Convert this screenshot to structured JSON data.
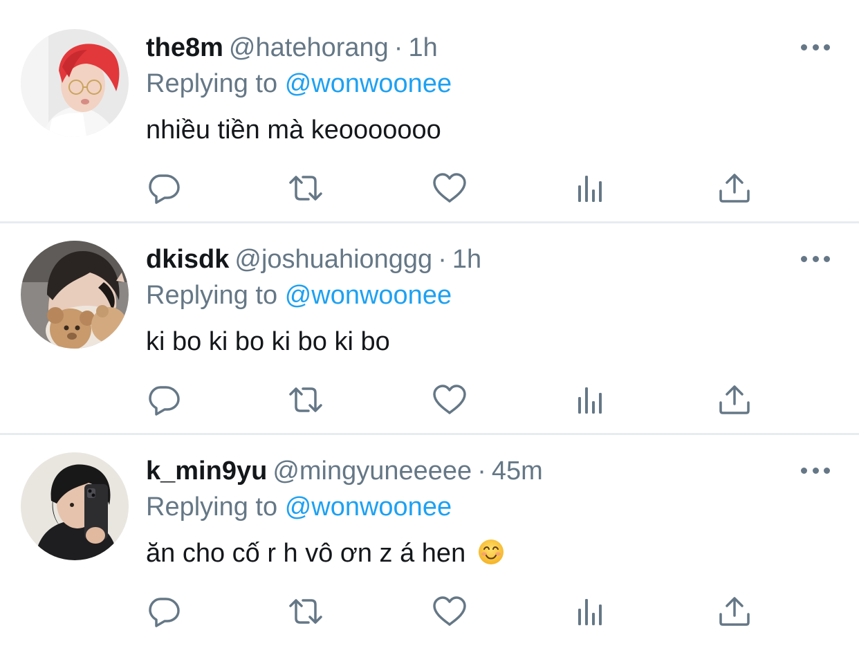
{
  "colors": {
    "text_primary": "#14171a",
    "text_secondary": "#657786",
    "link": "#1da1f2",
    "divider": "#e6ecf0"
  },
  "labels": {
    "replying_to": "Replying to",
    "separator": "·"
  },
  "tweets": [
    {
      "display_name": "the8m",
      "handle": "@hatehorang",
      "time": "1h",
      "replying_to_handle": "@wonwoonee",
      "text": "nhiều tiền mà keooooooo",
      "avatar_icon": "avatar-red-hair"
    },
    {
      "display_name": "dkisdk",
      "handle": "@joshuahionggg",
      "time": "1h",
      "replying_to_handle": "@wonwoonee",
      "text": "ki bo ki bo ki bo ki bo",
      "avatar_icon": "avatar-with-teddy-bear"
    },
    {
      "display_name": "k_min9yu",
      "handle": "@mingyuneeeee",
      "time": "45m",
      "replying_to_handle": "@wonwoonee",
      "text": "ăn cho cố r h vô ơn z á hen",
      "emoji": "smiling-face-emoji",
      "avatar_icon": "avatar-mirror-selfie"
    }
  ],
  "action_icons": [
    "reply-icon",
    "retweet-icon",
    "like-icon",
    "analytics-icon",
    "share-icon"
  ]
}
